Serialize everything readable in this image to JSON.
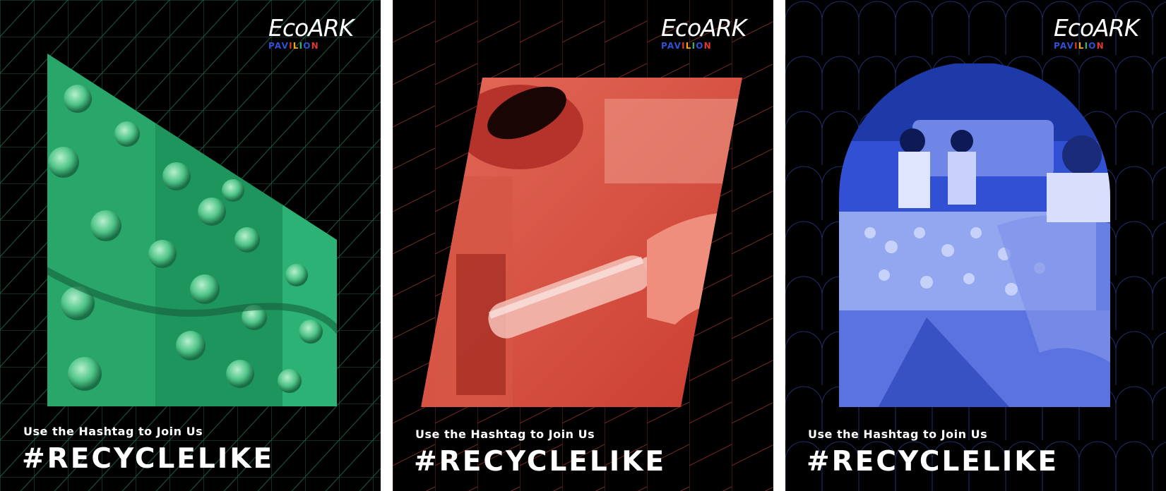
{
  "posters": [
    {
      "logo": {
        "brand": "EcoARK",
        "sub": "PAVILION"
      },
      "tagline": "Use the Hashtag to Join Us",
      "hashtag": "#RECYCLELIKE",
      "accent": "#1e9e62",
      "grid_color": "#1f5a44",
      "photo_alt": "green-plastic-bottle-wall-photo"
    },
    {
      "logo": {
        "brand": "EcoARK",
        "sub": "PAVILION"
      },
      "tagline": "Use the Hashtag to Join Us",
      "hashtag": "#RECYCLELIKE",
      "accent": "#d9493a",
      "grid_color": "#7a2a22",
      "photo_alt": "red-bottle-recycling-photo"
    },
    {
      "logo": {
        "brand": "EcoARK",
        "sub": "PAVILION"
      },
      "tagline": "Use the Hashtag to Join Us",
      "hashtag": "#RECYCLELIKE",
      "accent": "#2f52d6",
      "grid_color": "#1f2f6e",
      "photo_alt": "blue-volunteers-sorting-cans-photo"
    }
  ],
  "pavilion_letter_colors": [
    "#2f52d6",
    "#2f52d6",
    "#e03a2f",
    "#f0a81c",
    "#2bb673",
    "#2f52d6",
    "#e03a2f",
    "#f0a81c"
  ]
}
